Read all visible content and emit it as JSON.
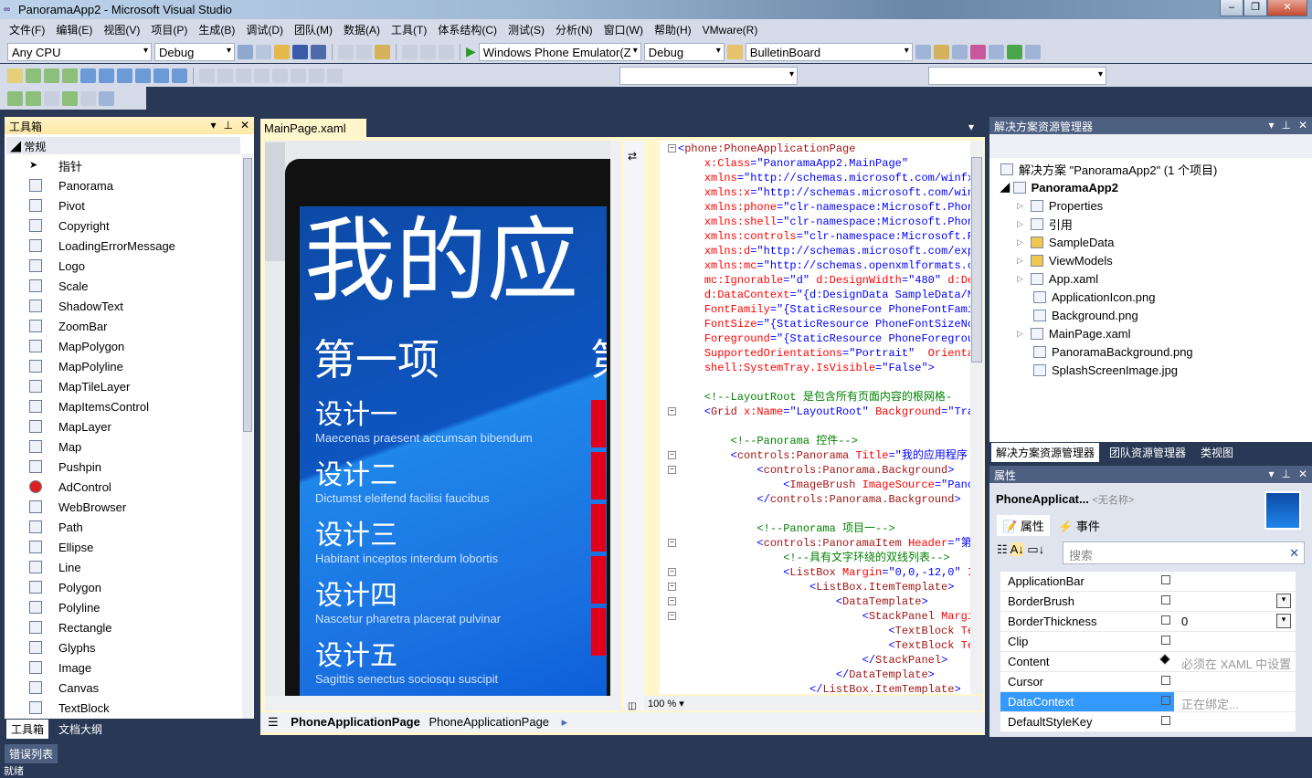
{
  "window": {
    "title": "PanoramaApp2 - Microsoft Visual Studio"
  },
  "menu": [
    "文件(F)",
    "编辑(E)",
    "视图(V)",
    "项目(P)",
    "生成(B)",
    "调试(D)",
    "团队(M)",
    "数据(A)",
    "工具(T)",
    "体系结构(C)",
    "测试(S)",
    "分析(N)",
    "窗口(W)",
    "帮助(H)",
    "VMware(R)"
  ],
  "toolbar": {
    "platform": "Any CPU",
    "config": "Debug",
    "target": "Windows Phone Emulator(Z",
    "config2": "Debug",
    "find": "BulletinBoard"
  },
  "toolbox": {
    "title": "工具箱",
    "group": "常规",
    "items": [
      "指针",
      "Panorama",
      "Pivot",
      "Copyright",
      "LoadingErrorMessage",
      "Logo",
      "Scale",
      "ShadowText",
      "ZoomBar",
      "MapPolygon",
      "MapPolyline",
      "MapTileLayer",
      "MapItemsControl",
      "MapLayer",
      "Map",
      "Pushpin",
      "AdControl",
      "WebBrowser",
      "Path",
      "Ellipse",
      "Line",
      "Polygon",
      "Polyline",
      "Rectangle",
      "Glyphs",
      "Image",
      "Canvas",
      "TextBlock"
    ],
    "tabs": [
      "工具箱",
      "文档大纲"
    ]
  },
  "error_tab": "错误列表",
  "status": "就绪",
  "editor": {
    "tab": "MainPage.xaml",
    "zoom": "100 %",
    "breadcrumb": [
      "PhoneApplicationPage",
      "PhoneApplicationPage"
    ],
    "phone": {
      "title": "我的应",
      "header": "第一项",
      "header_next": "第",
      "items": [
        {
          "h": "设计一",
          "s": "Maecenas praesent accumsan bibendum"
        },
        {
          "h": "设计二",
          "s": "Dictumst eleifend facilisi faucibus"
        },
        {
          "h": "设计三",
          "s": "Habitant inceptos interdum lobortis"
        },
        {
          "h": "设计四",
          "s": "Nascetur pharetra placerat pulvinar"
        },
        {
          "h": "设计五",
          "s": "Sagittis senectus sociosqu suscipit"
        }
      ]
    },
    "code": [
      [
        [
          "p",
          "<"
        ],
        [
          "t",
          "phone:PhoneApplicationPage"
        ]
      ],
      [
        [
          "p",
          "    "
        ],
        [
          "a",
          "x:Class"
        ],
        [
          "p",
          "=\"PanoramaApp2.MainPage\""
        ]
      ],
      [
        [
          "p",
          "    "
        ],
        [
          "a",
          "xmlns"
        ],
        [
          "p",
          "=\"http://schemas.microsoft.com/winfx/"
        ]
      ],
      [
        [
          "p",
          "    "
        ],
        [
          "a",
          "xmlns:x"
        ],
        [
          "p",
          "=\"http://schemas.microsoft.com/win"
        ]
      ],
      [
        [
          "p",
          "    "
        ],
        [
          "a",
          "xmlns:phone"
        ],
        [
          "p",
          "=\"clr-namespace:Microsoft.Phone"
        ]
      ],
      [
        [
          "p",
          "    "
        ],
        [
          "a",
          "xmlns:shell"
        ],
        [
          "p",
          "=\"clr-namespace:Microsoft.Phone"
        ]
      ],
      [
        [
          "p",
          "    "
        ],
        [
          "a",
          "xmlns:controls"
        ],
        [
          "p",
          "=\"clr-namespace:Microsoft.Pl"
        ]
      ],
      [
        [
          "p",
          "    "
        ],
        [
          "a",
          "xmlns:d"
        ],
        [
          "p",
          "=\"http://schemas.microsoft.com/exp"
        ]
      ],
      [
        [
          "p",
          "    "
        ],
        [
          "a",
          "xmlns:mc"
        ],
        [
          "p",
          "=\"http://schemas.openxmlformats.o"
        ]
      ],
      [
        [
          "p",
          "    "
        ],
        [
          "a",
          "mc:Ignorable"
        ],
        [
          "p",
          "=\"d\" "
        ],
        [
          "a",
          "d:DesignWidth"
        ],
        [
          "p",
          "=\"480\" "
        ],
        [
          "a",
          "d:De"
        ]
      ],
      [
        [
          "p",
          "    "
        ],
        [
          "a",
          "d:DataContext"
        ],
        [
          "p",
          "=\"{d:DesignData SampleData/M"
        ]
      ],
      [
        [
          "p",
          "    "
        ],
        [
          "a",
          "FontFamily"
        ],
        [
          "p",
          "=\"{StaticResource PhoneFontFami"
        ]
      ],
      [
        [
          "p",
          "    "
        ],
        [
          "a",
          "FontSize"
        ],
        [
          "p",
          "=\"{StaticResource PhoneFontSizeNo"
        ]
      ],
      [
        [
          "p",
          "    "
        ],
        [
          "a",
          "Foreground"
        ],
        [
          "p",
          "=\"{StaticResource PhoneForegrou"
        ]
      ],
      [
        [
          "p",
          "    "
        ],
        [
          "a",
          "SupportedOrientations"
        ],
        [
          "p",
          "=\"Portrait\"  "
        ],
        [
          "a",
          "Orienta"
        ]
      ],
      [
        [
          "p",
          "    "
        ],
        [
          "a",
          "shell:SystemTray.IsVisible"
        ],
        [
          "p",
          "=\"False\">"
        ]
      ],
      [],
      [
        [
          "c",
          "    <!--LayoutRoot 是包含所有页面内容的根网格-"
        ]
      ],
      [
        [
          "p",
          "    <"
        ],
        [
          "t",
          "Grid"
        ],
        [
          "p",
          " "
        ],
        [
          "a",
          "x:Name"
        ],
        [
          "p",
          "=\"LayoutRoot\" "
        ],
        [
          "a",
          "Background"
        ],
        [
          "p",
          "=\"Tra"
        ]
      ],
      [],
      [
        [
          "c",
          "        <!--Panorama 控件-->"
        ]
      ],
      [
        [
          "p",
          "        <"
        ],
        [
          "t",
          "controls:Panorama"
        ],
        [
          "p",
          " "
        ],
        [
          "a",
          "Title"
        ],
        [
          "p",
          "=\"我的应用程序"
        ]
      ],
      [
        [
          "p",
          "            <"
        ],
        [
          "t",
          "controls:Panorama.Background"
        ],
        [
          "p",
          ">"
        ]
      ],
      [
        [
          "p",
          "                <"
        ],
        [
          "t",
          "ImageBrush"
        ],
        [
          "p",
          " "
        ],
        [
          "a",
          "ImageSource"
        ],
        [
          "p",
          "=\"Pano"
        ]
      ],
      [
        [
          "p",
          "            </"
        ],
        [
          "t",
          "controls:Panorama.Background"
        ],
        [
          "p",
          ">"
        ]
      ],
      [],
      [
        [
          "c",
          "            <!--Panorama 项目一-->"
        ]
      ],
      [
        [
          "p",
          "            <"
        ],
        [
          "t",
          "controls:PanoramaItem"
        ],
        [
          "p",
          " "
        ],
        [
          "a",
          "Header"
        ],
        [
          "p",
          "=\"第"
        ]
      ],
      [
        [
          "c",
          "                <!--具有文字环绕的双线列表-->"
        ]
      ],
      [
        [
          "p",
          "                <"
        ],
        [
          "t",
          "ListBox"
        ],
        [
          "p",
          " "
        ],
        [
          "a",
          "Margin"
        ],
        [
          "p",
          "=\"0,0,-12,0\" "
        ],
        [
          "a",
          "I"
        ]
      ],
      [
        [
          "p",
          "                    <"
        ],
        [
          "t",
          "ListBox.ItemTemplate"
        ],
        [
          "p",
          ">"
        ]
      ],
      [
        [
          "p",
          "                        <"
        ],
        [
          "t",
          "DataTemplate"
        ],
        [
          "p",
          ">"
        ]
      ],
      [
        [
          "p",
          "                            <"
        ],
        [
          "t",
          "StackPanel"
        ],
        [
          "p",
          " "
        ],
        [
          "a",
          "Margin"
        ]
      ],
      [
        [
          "p",
          "                                <"
        ],
        [
          "t",
          "TextBlock"
        ],
        [
          "p",
          " "
        ],
        [
          "a",
          "Te"
        ]
      ],
      [
        [
          "p",
          "                                <"
        ],
        [
          "t",
          "TextBlock"
        ],
        [
          "p",
          " "
        ],
        [
          "a",
          "Te"
        ]
      ],
      [
        [
          "p",
          "                            </"
        ],
        [
          "t",
          "StackPanel"
        ],
        [
          "p",
          ">"
        ]
      ],
      [
        [
          "p",
          "                        </"
        ],
        [
          "t",
          "DataTemplate"
        ],
        [
          "p",
          ">"
        ]
      ],
      [
        [
          "p",
          "                    </"
        ],
        [
          "t",
          "ListBox.ItemTemplate"
        ],
        [
          "p",
          ">"
        ]
      ]
    ]
  },
  "solution": {
    "title": "解决方案资源管理器",
    "root": "解决方案 \"PanoramaApp2\" (1 个项目)",
    "project": "PanoramaApp2",
    "items": [
      "Properties",
      "引用",
      "SampleData",
      "ViewModels",
      "App.xaml",
      "ApplicationIcon.png",
      "Background.png",
      "MainPage.xaml",
      "PanoramaBackground.png",
      "SplashScreenImage.jpg"
    ],
    "tabs": [
      "解决方案资源管理器",
      "团队资源管理器",
      "类视图"
    ]
  },
  "properties": {
    "title": "属性",
    "object": "PhoneApplicat...",
    "name": "<无名称>",
    "tab_props": "属性",
    "tab_events": "事件",
    "search_placeholder": "搜索",
    "rows": [
      {
        "n": "ApplicationBar",
        "v": ""
      },
      {
        "n": "BorderBrush",
        "v": ""
      },
      {
        "n": "BorderThickness",
        "v": "0"
      },
      {
        "n": "Clip",
        "v": ""
      },
      {
        "n": "Content",
        "v": "必须在 XAML 中设置值"
      },
      {
        "n": "Cursor",
        "v": ""
      },
      {
        "n": "DataContext",
        "v": "正在绑定..."
      },
      {
        "n": "DefaultStyleKey",
        "v": ""
      }
    ]
  },
  "colors": {
    "accent": "#3399ff",
    "vs_bg": "#293955",
    "phone_blue": "#1a6fe0"
  }
}
